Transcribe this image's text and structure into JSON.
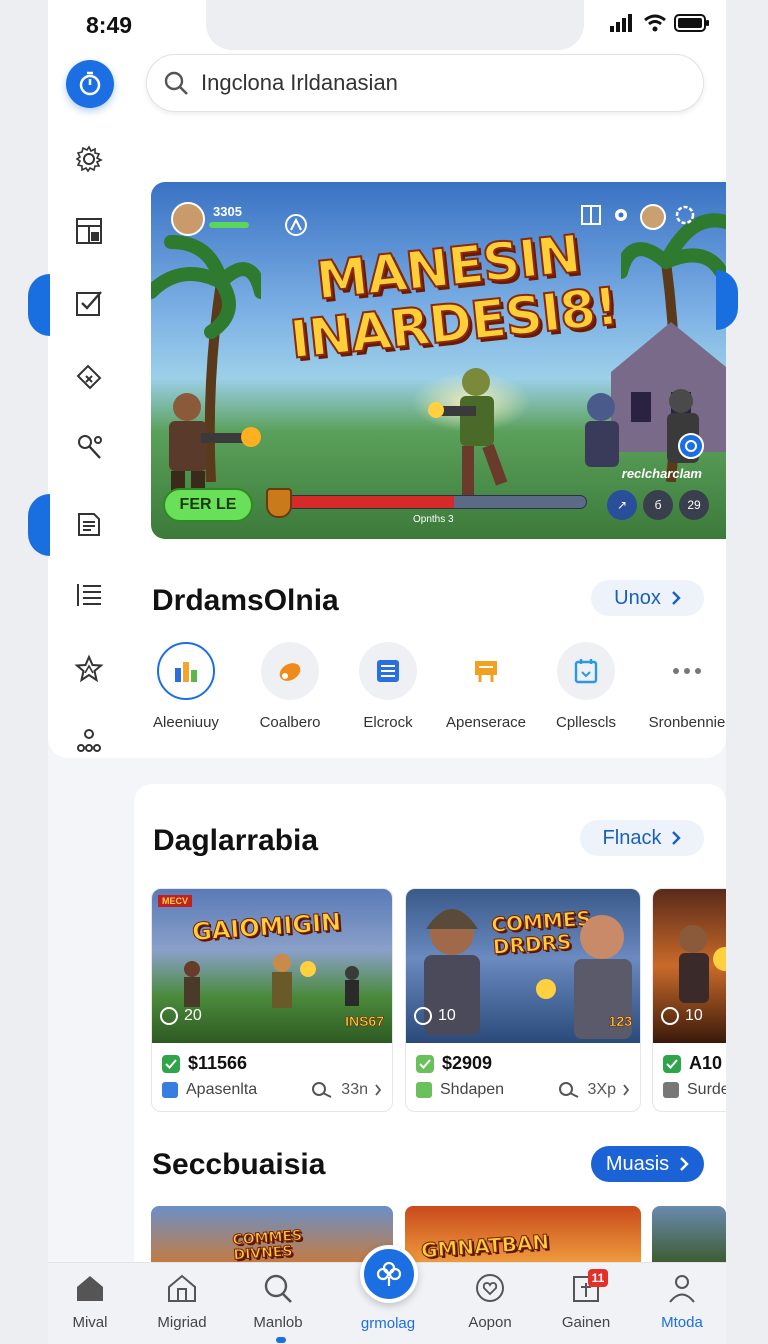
{
  "status_bar": {
    "time": "8:49"
  },
  "search": {
    "value": "Ingclona Irldanasian"
  },
  "sidebar": {
    "items": [
      {
        "icon": "refresh-timer-icon"
      },
      {
        "icon": "gear-icon"
      },
      {
        "icon": "layout-icon"
      },
      {
        "icon": "checkbox-icon"
      },
      {
        "icon": "tag-icon"
      },
      {
        "icon": "search-person-icon"
      },
      {
        "icon": "document-icon"
      },
      {
        "icon": "list-icon"
      },
      {
        "icon": "star-icon"
      },
      {
        "icon": "group-icon"
      }
    ]
  },
  "hero": {
    "title_line1": "MANESIN",
    "title_line2": "INARDESI8!",
    "score": "3305",
    "play_label": "FER LE",
    "health_label": "Opnths 3",
    "health_level": 0.58,
    "caption": "reclcharclam",
    "round_buttons": [
      "↗",
      "б",
      "29"
    ]
  },
  "section1": {
    "title": "DrdamsOlnia",
    "action_label": "Unox"
  },
  "categories": [
    {
      "label": "Aleeniuuy",
      "icon": "chart-icon",
      "color": "#f2a62b"
    },
    {
      "label": "Coalbero",
      "icon": "hand-icon",
      "color": "#f08a1a"
    },
    {
      "label": "Elcrock",
      "icon": "lines-icon",
      "color": "#2a6fe0"
    },
    {
      "label": "Apenserace",
      "icon": "card-icon",
      "color": "#f2a020"
    },
    {
      "label": "Cpllescls",
      "icon": "calendar-icon",
      "color": "#2a9ae0"
    },
    {
      "label": "Sronbennie",
      "icon": "more-icon",
      "color": "#666666"
    }
  ],
  "section2": {
    "title": "Daglarrabia",
    "action_label": "Flnack"
  },
  "games": [
    {
      "art_title": "GAIOMIGIN",
      "badge": "MECV",
      "count": "20",
      "tag": "INS67",
      "price": "$11566",
      "category": "Apasenlta",
      "meta": "33n"
    },
    {
      "art_title": "COMMES DRDRS",
      "count": "10",
      "tag": "123",
      "price": "$2909",
      "category": "Shdapen",
      "meta": "3Xp"
    },
    {
      "art_title": "",
      "count": "10",
      "price": "A10",
      "category": "Surde"
    }
  ],
  "section3": {
    "title": "Seccbuaisia",
    "action_label": "Muasis"
  },
  "thumbs": [
    {
      "art_title": "COMMES DIVNES"
    },
    {
      "art_title": "GMNATBAN"
    }
  ],
  "bottom_nav": [
    {
      "label": "Mival",
      "icon": "home-icon"
    },
    {
      "label": "Migriad",
      "icon": "house-outline-icon"
    },
    {
      "label": "Manlob",
      "icon": "search-icon"
    },
    {
      "label": "grmolag",
      "icon": "clover-icon"
    },
    {
      "label": "Aopon",
      "icon": "heart-icon"
    },
    {
      "label": "Gainen",
      "icon": "box-icon",
      "badge": "11"
    },
    {
      "label": "Mtoda",
      "icon": "profile-icon"
    }
  ],
  "colors": {
    "accent": "#1b6fe3",
    "play": "#6ae05a",
    "health": "#d62a2a"
  }
}
